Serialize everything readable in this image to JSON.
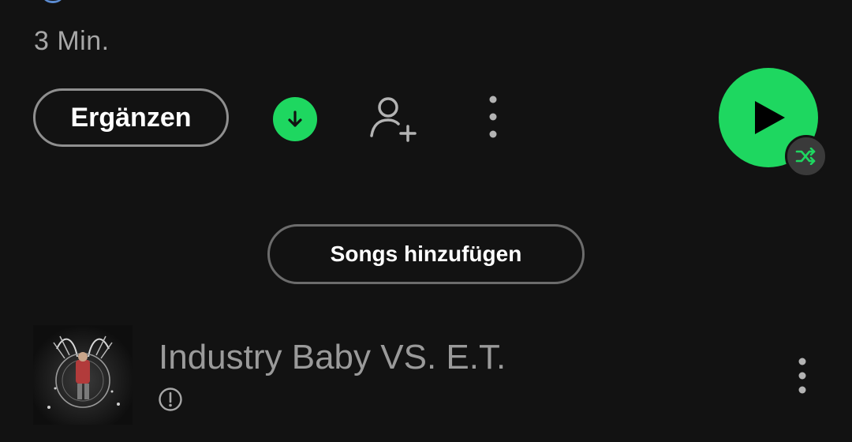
{
  "header": {
    "duration": "3 Min."
  },
  "actions": {
    "add_label": "Ergänzen",
    "download_icon": "download-icon",
    "invite_icon": "add-user-icon",
    "more_icon": "more-vertical-icon",
    "play_icon": "play-icon",
    "shuffle_icon": "shuffle-icon",
    "accent": "#1ed760"
  },
  "add_songs": {
    "label": "Songs hinzufügen"
  },
  "tracks": [
    {
      "title": "Industry Baby VS. E.T.",
      "status_icon": "unavailable-icon",
      "more_icon": "more-vertical-icon"
    }
  ]
}
